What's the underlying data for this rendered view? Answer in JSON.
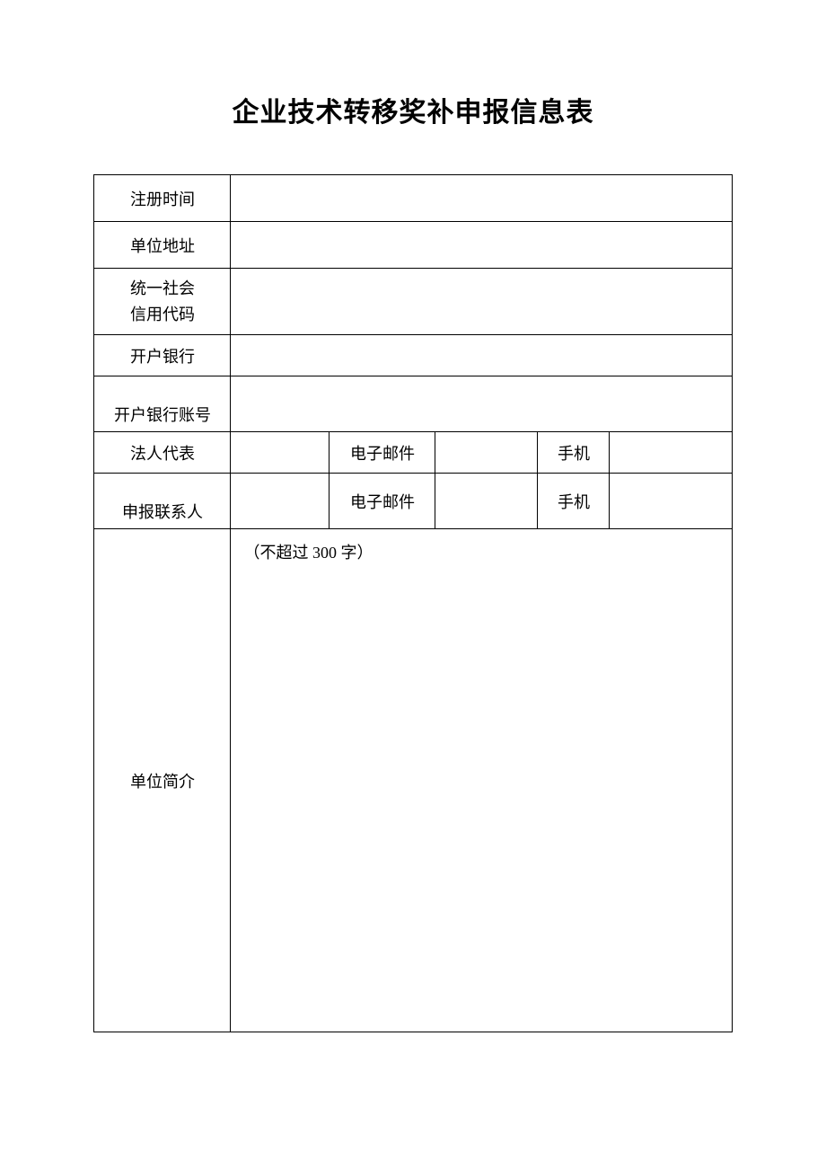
{
  "title": "企业技术转移奖补申报信息表",
  "rows": {
    "reg_time_label": "注册时间",
    "reg_time_value": "",
    "address_label": "单位地址",
    "address_value": "",
    "usc_code_label_line1": "统一社会",
    "usc_code_label_line2": "信用代码",
    "usc_code_value": "",
    "bank_label": "开户银行",
    "bank_value": "",
    "bank_acct_label": "开户银行账号",
    "bank_acct_value": "",
    "legal_rep_label": "法人代表",
    "legal_rep_value": "",
    "email_label": "电子邮件",
    "legal_rep_email": "",
    "phone_label": "手机",
    "legal_rep_phone": "",
    "contact_label": "申报联系人",
    "contact_value": "",
    "contact_email": "",
    "contact_phone": "",
    "intro_label": "单位简介",
    "intro_hint": "（不超过 300 字）"
  }
}
